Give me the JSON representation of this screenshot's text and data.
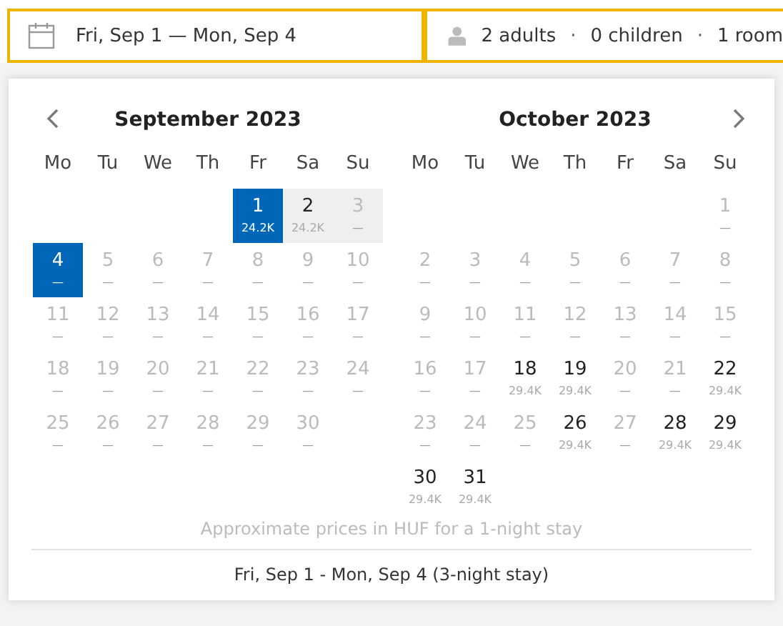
{
  "search_bar": {
    "dates": "Fri, Sep 1 — Mon, Sep 4",
    "guests": [
      "2 adults",
      "·",
      "0 children",
      "·",
      "1 room"
    ]
  },
  "calendar": {
    "months": [
      {
        "title": "September 2023",
        "weekdays": [
          "Mo",
          "Tu",
          "We",
          "Th",
          "Fr",
          "Sa",
          "Su"
        ],
        "weeks": [
          [
            {
              "kind": "blank"
            },
            {
              "kind": "blank"
            },
            {
              "kind": "blank"
            },
            {
              "kind": "blank"
            },
            {
              "kind": "day",
              "day": "1",
              "price": "24.2K",
              "available": true,
              "selected": true,
              "in_range": false
            },
            {
              "kind": "day",
              "day": "2",
              "price": "24.2K",
              "available": true,
              "selected": false,
              "in_range": true
            },
            {
              "kind": "day",
              "day": "3",
              "price": "—",
              "available": false,
              "selected": false,
              "in_range": true
            }
          ],
          [
            {
              "kind": "day",
              "day": "4",
              "price": "—",
              "available": false,
              "selected": true,
              "in_range": false
            },
            {
              "kind": "day",
              "day": "5",
              "price": "—",
              "available": false,
              "selected": false,
              "in_range": false
            },
            {
              "kind": "day",
              "day": "6",
              "price": "—",
              "available": false,
              "selected": false,
              "in_range": false
            },
            {
              "kind": "day",
              "day": "7",
              "price": "—",
              "available": false,
              "selected": false,
              "in_range": false
            },
            {
              "kind": "day",
              "day": "8",
              "price": "—",
              "available": false,
              "selected": false,
              "in_range": false
            },
            {
              "kind": "day",
              "day": "9",
              "price": "—",
              "available": false,
              "selected": false,
              "in_range": false
            },
            {
              "kind": "day",
              "day": "10",
              "price": "—",
              "available": false,
              "selected": false,
              "in_range": false
            }
          ],
          [
            {
              "kind": "day",
              "day": "11",
              "price": "—",
              "available": false,
              "selected": false,
              "in_range": false
            },
            {
              "kind": "day",
              "day": "12",
              "price": "—",
              "available": false,
              "selected": false,
              "in_range": false
            },
            {
              "kind": "day",
              "day": "13",
              "price": "—",
              "available": false,
              "selected": false,
              "in_range": false
            },
            {
              "kind": "day",
              "day": "14",
              "price": "—",
              "available": false,
              "selected": false,
              "in_range": false
            },
            {
              "kind": "day",
              "day": "15",
              "price": "—",
              "available": false,
              "selected": false,
              "in_range": false
            },
            {
              "kind": "day",
              "day": "16",
              "price": "—",
              "available": false,
              "selected": false,
              "in_range": false
            },
            {
              "kind": "day",
              "day": "17",
              "price": "—",
              "available": false,
              "selected": false,
              "in_range": false
            }
          ],
          [
            {
              "kind": "day",
              "day": "18",
              "price": "—",
              "available": false,
              "selected": false,
              "in_range": false
            },
            {
              "kind": "day",
              "day": "19",
              "price": "—",
              "available": false,
              "selected": false,
              "in_range": false
            },
            {
              "kind": "day",
              "day": "20",
              "price": "—",
              "available": false,
              "selected": false,
              "in_range": false
            },
            {
              "kind": "day",
              "day": "21",
              "price": "—",
              "available": false,
              "selected": false,
              "in_range": false
            },
            {
              "kind": "day",
              "day": "22",
              "price": "—",
              "available": false,
              "selected": false,
              "in_range": false
            },
            {
              "kind": "day",
              "day": "23",
              "price": "—",
              "available": false,
              "selected": false,
              "in_range": false
            },
            {
              "kind": "day",
              "day": "24",
              "price": "—",
              "available": false,
              "selected": false,
              "in_range": false
            }
          ],
          [
            {
              "kind": "day",
              "day": "25",
              "price": "—",
              "available": false,
              "selected": false,
              "in_range": false
            },
            {
              "kind": "day",
              "day": "26",
              "price": "—",
              "available": false,
              "selected": false,
              "in_range": false
            },
            {
              "kind": "day",
              "day": "27",
              "price": "—",
              "available": false,
              "selected": false,
              "in_range": false
            },
            {
              "kind": "day",
              "day": "28",
              "price": "—",
              "available": false,
              "selected": false,
              "in_range": false
            },
            {
              "kind": "day",
              "day": "29",
              "price": "—",
              "available": false,
              "selected": false,
              "in_range": false
            },
            {
              "kind": "day",
              "day": "30",
              "price": "—",
              "available": false,
              "selected": false,
              "in_range": false
            }
          ]
        ]
      },
      {
        "title": "October 2023",
        "weekdays": [
          "Mo",
          "Tu",
          "We",
          "Th",
          "Fr",
          "Sa",
          "Su"
        ],
        "weeks": [
          [
            {
              "kind": "blank"
            },
            {
              "kind": "blank"
            },
            {
              "kind": "blank"
            },
            {
              "kind": "blank"
            },
            {
              "kind": "blank"
            },
            {
              "kind": "blank"
            },
            {
              "kind": "day",
              "day": "1",
              "price": "—",
              "available": false,
              "selected": false,
              "in_range": false
            }
          ],
          [
            {
              "kind": "day",
              "day": "2",
              "price": "—",
              "available": false,
              "selected": false,
              "in_range": false
            },
            {
              "kind": "day",
              "day": "3",
              "price": "—",
              "available": false,
              "selected": false,
              "in_range": false
            },
            {
              "kind": "day",
              "day": "4",
              "price": "—",
              "available": false,
              "selected": false,
              "in_range": false
            },
            {
              "kind": "day",
              "day": "5",
              "price": "—",
              "available": false,
              "selected": false,
              "in_range": false
            },
            {
              "kind": "day",
              "day": "6",
              "price": "—",
              "available": false,
              "selected": false,
              "in_range": false
            },
            {
              "kind": "day",
              "day": "7",
              "price": "—",
              "available": false,
              "selected": false,
              "in_range": false
            },
            {
              "kind": "day",
              "day": "8",
              "price": "—",
              "available": false,
              "selected": false,
              "in_range": false
            }
          ],
          [
            {
              "kind": "day",
              "day": "9",
              "price": "—",
              "available": false,
              "selected": false,
              "in_range": false
            },
            {
              "kind": "day",
              "day": "10",
              "price": "—",
              "available": false,
              "selected": false,
              "in_range": false
            },
            {
              "kind": "day",
              "day": "11",
              "price": "—",
              "available": false,
              "selected": false,
              "in_range": false
            },
            {
              "kind": "day",
              "day": "12",
              "price": "—",
              "available": false,
              "selected": false,
              "in_range": false
            },
            {
              "kind": "day",
              "day": "13",
              "price": "—",
              "available": false,
              "selected": false,
              "in_range": false
            },
            {
              "kind": "day",
              "day": "14",
              "price": "—",
              "available": false,
              "selected": false,
              "in_range": false
            },
            {
              "kind": "day",
              "day": "15",
              "price": "—",
              "available": false,
              "selected": false,
              "in_range": false
            }
          ],
          [
            {
              "kind": "day",
              "day": "16",
              "price": "—",
              "available": false,
              "selected": false,
              "in_range": false
            },
            {
              "kind": "day",
              "day": "17",
              "price": "—",
              "available": false,
              "selected": false,
              "in_range": false
            },
            {
              "kind": "day",
              "day": "18",
              "price": "29.4K",
              "available": true,
              "selected": false,
              "in_range": false
            },
            {
              "kind": "day",
              "day": "19",
              "price": "29.4K",
              "available": true,
              "selected": false,
              "in_range": false
            },
            {
              "kind": "day",
              "day": "20",
              "price": "—",
              "available": false,
              "selected": false,
              "in_range": false
            },
            {
              "kind": "day",
              "day": "21",
              "price": "—",
              "available": false,
              "selected": false,
              "in_range": false
            },
            {
              "kind": "day",
              "day": "22",
              "price": "29.4K",
              "available": true,
              "selected": false,
              "in_range": false
            }
          ],
          [
            {
              "kind": "day",
              "day": "23",
              "price": "—",
              "available": false,
              "selected": false,
              "in_range": false
            },
            {
              "kind": "day",
              "day": "24",
              "price": "—",
              "available": false,
              "selected": false,
              "in_range": false
            },
            {
              "kind": "day",
              "day": "25",
              "price": "—",
              "available": false,
              "selected": false,
              "in_range": false
            },
            {
              "kind": "day",
              "day": "26",
              "price": "29.4K",
              "available": true,
              "selected": false,
              "in_range": false
            },
            {
              "kind": "day",
              "day": "27",
              "price": "—",
              "available": false,
              "selected": false,
              "in_range": false
            },
            {
              "kind": "day",
              "day": "28",
              "price": "29.4K",
              "available": true,
              "selected": false,
              "in_range": false
            },
            {
              "kind": "day",
              "day": "29",
              "price": "29.4K",
              "available": true,
              "selected": false,
              "in_range": false
            }
          ],
          [
            {
              "kind": "day",
              "day": "30",
              "price": "29.4K",
              "available": true,
              "selected": false,
              "in_range": false
            },
            {
              "kind": "day",
              "day": "31",
              "price": "29.4K",
              "available": true,
              "selected": false,
              "in_range": false
            }
          ]
        ]
      }
    ],
    "note": "Approximate prices in HUF for a 1-night stay",
    "summary": "Fri, Sep 1 - Mon, Sep 4 (3-night stay)"
  }
}
